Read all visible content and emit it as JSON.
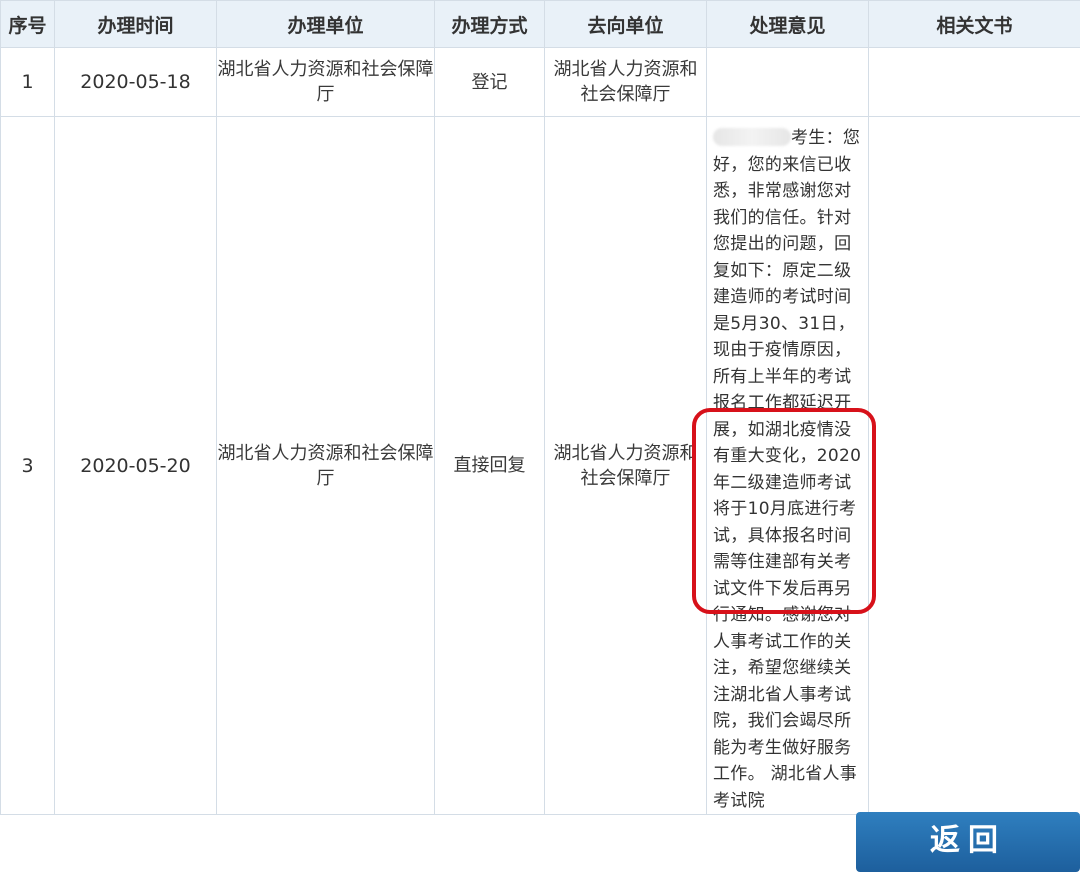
{
  "table": {
    "headers": [
      "序号",
      "办理时间",
      "办理单位",
      "办理方式",
      "去向单位",
      "处理意见",
      "相关文书"
    ],
    "rows": [
      {
        "seq": "1",
        "date": "2020-05-18",
        "unit": "湖北省人力资源和社会保障厅",
        "method": "登记",
        "destination": "湖北省人力资源和社会保障厅",
        "opinion": "",
        "documents": ""
      },
      {
        "seq": "3",
        "date": "2020-05-20",
        "unit": "湖北省人力资源和社会保障厅",
        "method": "直接回复",
        "destination": "湖北省人力资源和社会保障厅",
        "opinion_prefix": "考生：您好，您的来信已收悉，非常感谢您对我们的信任。针对您提出的问题，回复如下：原定二级建造师的考试时间是5月30、31日，现由于疫情原因，所有上半年的考试报名工作都延迟开展，如湖北疫情没有重大变化，2020年二级建造师考试将于10月底进行考试，具体报名时间需等住建部有关考试文件下发后再另行通知。感谢您对人事考试工作的关注，希望您继续关注湖北省人事考试院，我们会竭尽所能为考生做好服务工作。 湖北省人事考试院",
        "documents": ""
      }
    ]
  },
  "buttons": {
    "return_label": "返回"
  },
  "colors": {
    "header_bg": "#e9f1f8",
    "border": "#d4dde6",
    "highlight": "#d7111a",
    "button": "#1d5f9d"
  }
}
